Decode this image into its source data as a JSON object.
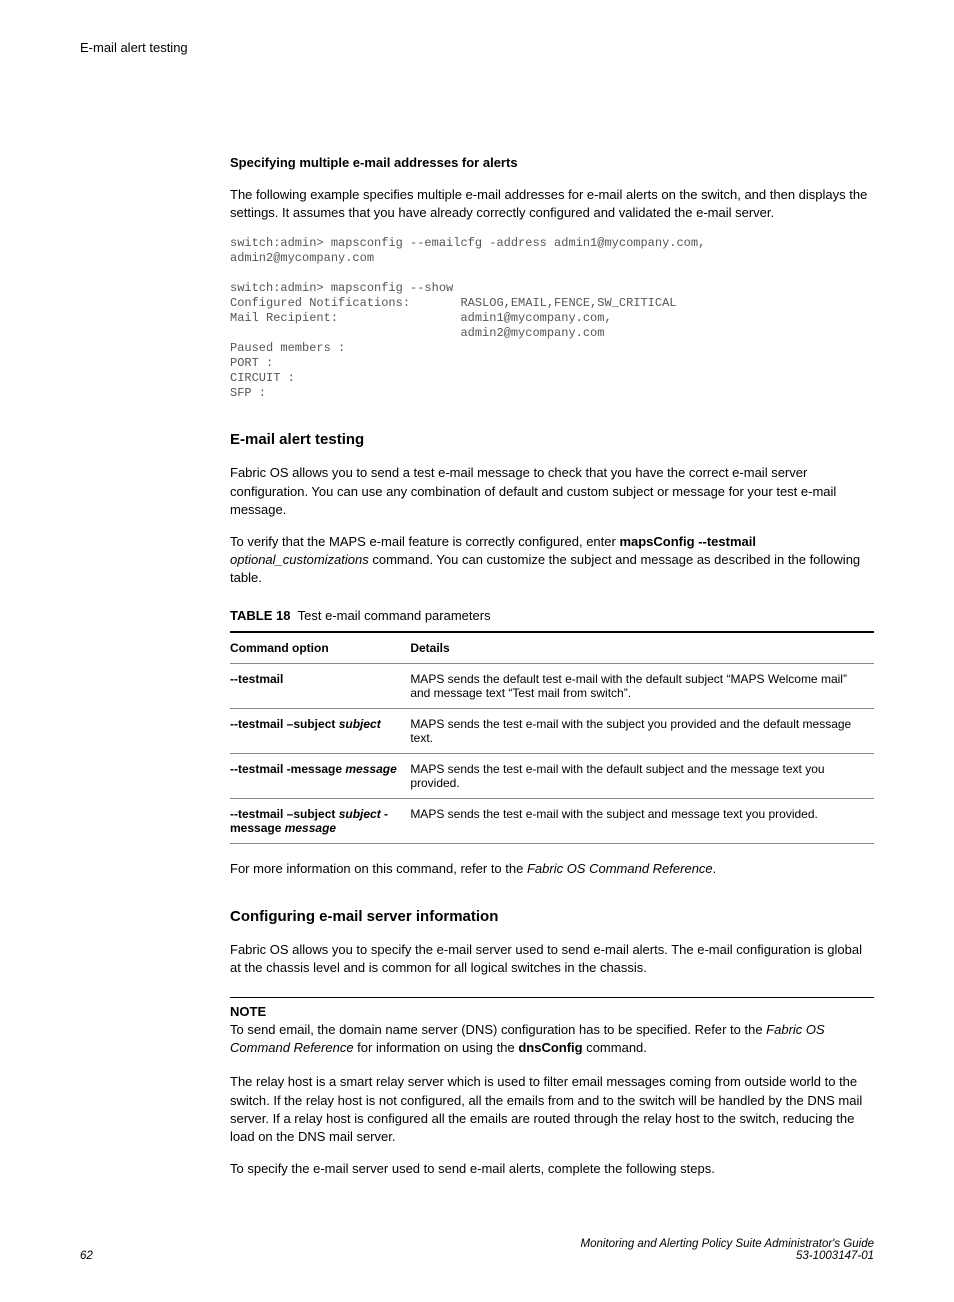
{
  "runningHeader": "E-mail alert testing",
  "section1": {
    "heading": "Specifying multiple e-mail addresses for alerts",
    "p1": "The following example specifies multiple e-mail addresses for e-mail alerts on the switch, and then displays the settings. It assumes that you have already correctly configured and validated the e-mail server.",
    "code": "switch:admin> mapsconfig --emailcfg -address admin1@mycompany.com,\nadmin2@mycompany.com\n\nswitch:admin> mapsconfig --show\nConfigured Notifications:       RASLOG,EMAIL,FENCE,SW_CRITICAL\nMail Recipient:                 admin1@mycompany.com,\n                                admin2@mycompany.com\nPaused members :\nPORT :\nCIRCUIT :\nSFP :"
  },
  "section2": {
    "heading": "E-mail alert testing",
    "p1": "Fabric OS allows you to send a test e-mail message to check that you have the correct e-mail server configuration. You can use any combination of default and custom subject or message for your test e-mail message.",
    "p2_pre": "To verify that the MAPS e-mail feature is correctly configured, enter ",
    "p2_cmd": "mapsConfig --testmail",
    "p2_opt": "optional_customizations",
    "p2_post": " command. You can customize the subject and message as described in the following table.",
    "tableCaptionLabel": "TABLE 18",
    "tableCaptionText": "Test e-mail command parameters",
    "tableHeaders": {
      "opt": "Command option",
      "det": "Details"
    },
    "rows": [
      {
        "opt_bold": "--testmail",
        "opt_italic": "",
        "det": "MAPS sends the default test e-mail with the default subject “MAPS Welcome mail” and message text “Test mail from switch”."
      },
      {
        "opt_bold": "--testmail –subject ",
        "opt_italic": "subject",
        "det": "MAPS sends the test e-mail with the subject you provided and the default message text."
      },
      {
        "opt_bold": "--testmail -message ",
        "opt_italic": "message",
        "det": "MAPS sends the test e-mail with the default subject and the message text you provided."
      },
      {
        "opt_bold": "--testmail –subject ",
        "opt_italic": "subject",
        "opt_bold2": " -message ",
        "opt_italic2": "message",
        "det": "MAPS sends the test e-mail with the subject and message text you provided."
      }
    ],
    "afterTable_pre": "For more information on this command, refer to the ",
    "afterTable_ref": "Fabric OS Command Reference",
    "afterTable_post": "."
  },
  "section3": {
    "heading": "Configuring e-mail server information",
    "p1": "Fabric OS allows you to specify the e-mail server used to send e-mail alerts. The e-mail configuration is global at the chassis level and is common for all logical switches in the chassis.",
    "noteLabel": "NOTE",
    "note_pre": "To send email, the domain name server (DNS) configuration has to be specified. Refer to the ",
    "note_ref": "Fabric OS Command Reference",
    "note_mid": " for information on using the ",
    "note_cmd": "dnsConfig",
    "note_post": " command.",
    "p2": "The relay host is a smart relay server which is used to filter email messages coming from outside world to the switch. If the relay host is not configured, all the emails from and to the switch will be handled by the DNS mail server. If a relay host is configured all the emails are routed through the relay host to the switch, reducing the load on the DNS mail server.",
    "p3": "To specify the e-mail server used to send e-mail alerts, complete the following steps."
  },
  "footer": {
    "page": "62",
    "title": "Monitoring and Alerting Policy Suite Administrator's Guide",
    "docnum": "53-1003147-01"
  }
}
